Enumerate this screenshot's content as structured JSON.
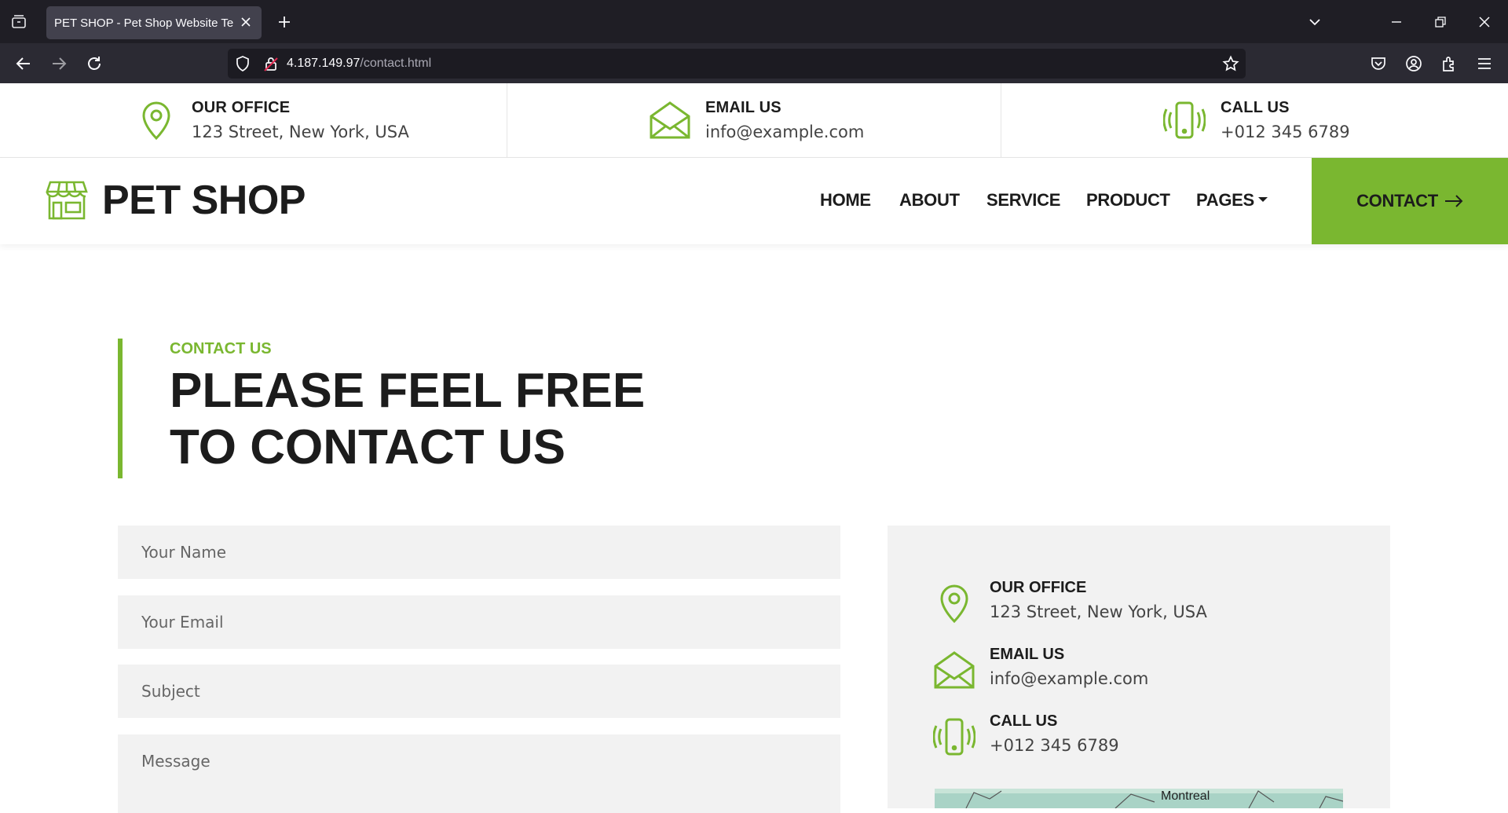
{
  "browser": {
    "tab_title": "PET SHOP - Pet Shop Website Temp",
    "url_host": "4.187.149.97",
    "url_path": "/contact.html"
  },
  "topinfo": {
    "office": {
      "label": "OUR OFFICE",
      "value": "123 Street, New York, USA"
    },
    "email": {
      "label": "EMAIL US",
      "value": "info@example.com"
    },
    "call": {
      "label": "CALL US",
      "value": "+012 345 6789"
    }
  },
  "header": {
    "logo": "PET SHOP",
    "menu": [
      "HOME",
      "ABOUT",
      "SERVICE",
      "PRODUCT",
      "PAGES"
    ],
    "cta": "CONTACT"
  },
  "section": {
    "subtitle": "CONTACT US",
    "title": "PLEASE FEEL FREE TO CONTACT US"
  },
  "form": {
    "name_placeholder": "Your Name",
    "email_placeholder": "Your Email",
    "subject_placeholder": "Subject",
    "message_placeholder": "Message"
  },
  "contact_box": {
    "office": {
      "label": "OUR OFFICE",
      "value": "123 Street, New York, USA"
    },
    "email": {
      "label": "EMAIL US",
      "value": "info@example.com"
    },
    "call": {
      "label": "CALL US",
      "value": "+012 345 6789"
    },
    "map_label": "Montreal"
  },
  "colors": {
    "accent": "#7ab730",
    "dark": "#1c1c1c",
    "field_bg": "#f2f2f2"
  }
}
